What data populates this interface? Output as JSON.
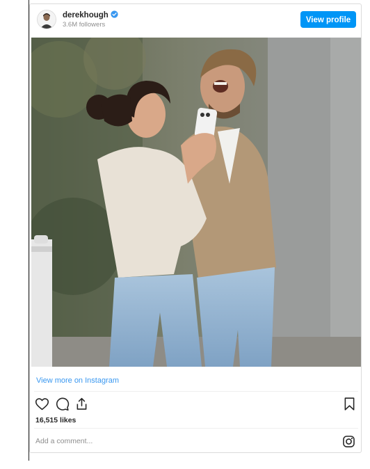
{
  "header": {
    "username": "derekhough",
    "followers": "3.6M followers",
    "view_profile_label": "View profile",
    "avatar_icon": "profile-picture"
  },
  "post": {
    "photo_alt": "Woman in cream sweater and man in tan cardigan laughing outdoors",
    "view_more_label": "View more on Instagram",
    "likes": "16,515 likes",
    "comment_placeholder": "Add a comment..."
  },
  "icons": {
    "verified": "verified-badge-icon",
    "like": "heart-icon",
    "comment": "comment-icon",
    "share": "share-icon",
    "save": "bookmark-icon",
    "instagram": "instagram-logo-icon"
  },
  "colors": {
    "accent": "#0095f6",
    "link": "#3897f0",
    "verified": "#3897f0",
    "text": "#262626",
    "muted": "#8e8e8e"
  }
}
